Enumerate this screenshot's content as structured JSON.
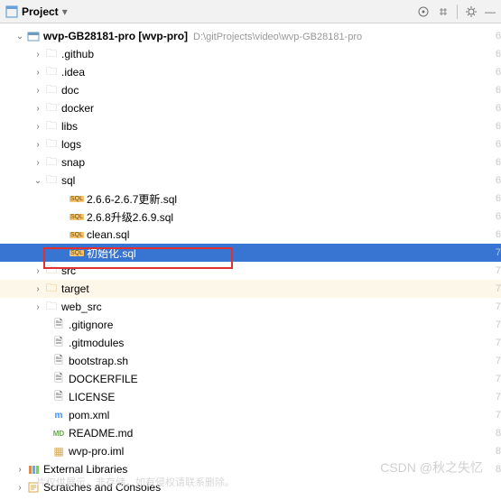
{
  "toolbar": {
    "title": "Project"
  },
  "root": {
    "name": "wvp-GB28181-pro",
    "module": "[wvp-pro]",
    "path": "D:\\gitProjects\\video\\wvp-GB28181-pro"
  },
  "folders": {
    "github": ".github",
    "idea": ".idea",
    "doc": "doc",
    "docker": "docker",
    "libs": "libs",
    "logs": "logs",
    "snap": "snap",
    "sql": "sql",
    "src": "src",
    "target": "target",
    "websrc": "web_src"
  },
  "sql_files": {
    "f1": "2.6.6-2.6.7更新.sql",
    "f2": "2.6.8升级2.6.9.sql",
    "f3": "clean.sql",
    "f4": "初始化.sql"
  },
  "files": {
    "gitignore": ".gitignore",
    "gitmodules": ".gitmodules",
    "bootstrap": "bootstrap.sh",
    "dockerfile": "DOCKERFILE",
    "license": "LICENSE",
    "pom": "pom.xml",
    "readme": "README.md",
    "iml": "wvp-pro.iml"
  },
  "bottom": {
    "ext_lib": "External Libraries",
    "scratch": "Scratches and Consoles"
  },
  "gutter": [
    "6",
    "6",
    "6",
    "6",
    "6",
    "6",
    "6",
    "6",
    "6",
    "6",
    "6",
    "6",
    "7",
    "7",
    "7",
    "7",
    "7",
    "7",
    "7",
    "7",
    "7",
    "7",
    "8",
    "8",
    "8"
  ],
  "watermark": "CSDN @秋之失忆",
  "watermark2": "片仅供展示，非存储，如有侵权请联系删除。"
}
